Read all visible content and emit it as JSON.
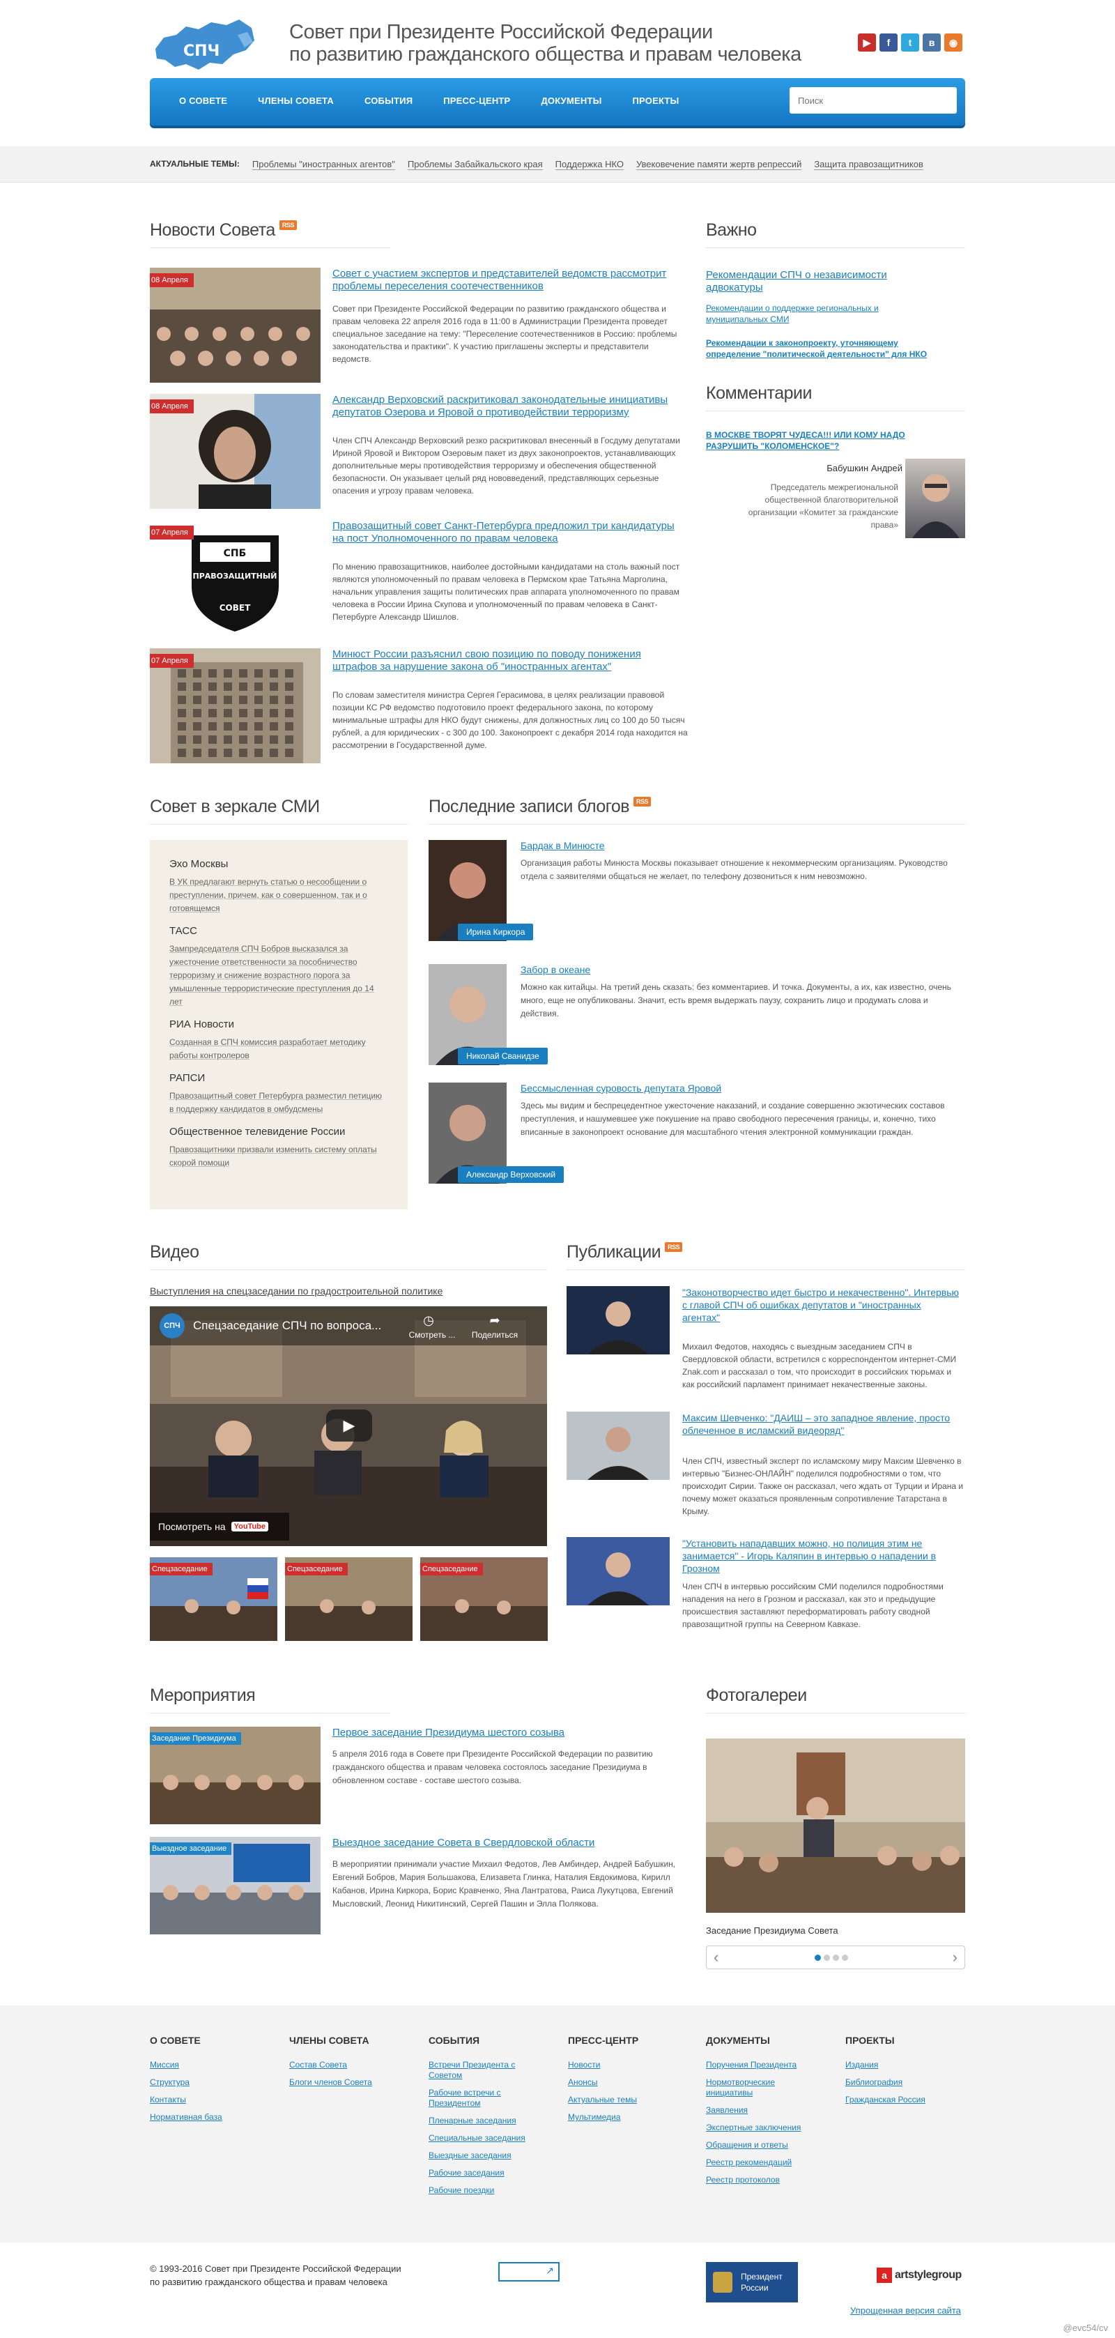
{
  "header": {
    "logo_text": "СПЧ",
    "title_line1": "Совет при Президенте Российской Федерации",
    "title_line2": "по развитию гражданского общества и правам человека",
    "social": [
      {
        "name": "youtube-icon",
        "glyph": "▶",
        "color": "#c8312b"
      },
      {
        "name": "facebook-icon",
        "glyph": "f",
        "color": "#3b5998"
      },
      {
        "name": "twitter-icon",
        "glyph": "t",
        "color": "#2fa8e0"
      },
      {
        "name": "vk-icon",
        "glyph": "в",
        "color": "#4c75a3"
      },
      {
        "name": "rss-icon",
        "glyph": "◉",
        "color": "#e9792d"
      }
    ]
  },
  "nav": {
    "items": [
      "О совете",
      "Члены совета",
      "События",
      "Пресс-центр",
      "Документы",
      "Проекты"
    ],
    "search_placeholder": "Поиск"
  },
  "topics": {
    "label": "Актуальные темы:",
    "items": [
      "Проблемы \"иностранных агентов\"",
      "Проблемы Забайкальского края",
      "Поддержка НКО",
      "Увековечение памяти жертв репрессий",
      "Защита правозащитников"
    ]
  },
  "news": {
    "title": "Новости Совета",
    "rss": "RSS",
    "items": [
      {
        "date": "08 Апреля",
        "title": "Совет с участием экспертов и представителей ведомств рассмотрит проблемы переселения соотечественников",
        "text": "Совет при Президенте Российской Федерации по развитию гражданского общества и правам человека 22 апреля 2016 года в 11:00 в Администрации Президента проведет специальное заседание на тему: \"Переселение соотечественников в Россию: проблемы законодательства и практики\". К участию приглашены эксперты и представители ведомств."
      },
      {
        "date": "08 Апреля",
        "title": "Александр Верховский раскритиковал законодательные инициативы депутатов Озерова и Яровой о противодействии терроризму",
        "text": "Член СПЧ Александр Верховский резко раскритиковал внесенный в Госдуму депутатами Ириной Яровой и Виктором Озеровым пакет из двух законопроектов, устанавливающих дополнительные меры противодействия терроризму и обеспечения общественной безопасности. Он указывает целый ряд нововведений, представляющих серьезные опасения и угрозу правам человека."
      },
      {
        "date": "07 Апреля",
        "title": "Правозащитный совет Санкт-Петербурга предложил три кандидатуры на пост Уполномоченного по правам человека",
        "text": "По мнению правозащитников, наиболее достойными кандидатами на столь важный пост являются уполномоченный по правам человека в Пермском крае Татьяна Марголина, начальник управления защиты политических прав аппарата уполномоченного по правам человека в России Ирина Скупова и уполномоченный по правам человека в Санкт-Петербурге Александр Шишлов."
      },
      {
        "date": "07 Апреля",
        "title": "Минюст России разъяснил свою позицию по поводу понижения штрафов за нарушение закона об \"иностранных агентах\"",
        "text": "По словам заместителя министра Сергея Герасимова, в целях реализации правовой позиции КС РФ ведомство подготовило проект федерального закона, по которому минимальные штрафы для НКО будут снижены, для должностных лиц со 100 до 50 тысяч рублей, а для юридических - с 300 до 100. Законопроект с декабря 2014 года находится на рассмотрении в Государственной думе."
      }
    ],
    "logo_badge_top": "СПБ",
    "logo_badge_mid": "ПРАВОЗАЩИТНЫЙ",
    "logo_badge_bottom": "СОВЕТ"
  },
  "important": {
    "title": "Важно",
    "links": [
      "Рекомендации СПЧ о независимости адвокатуры",
      "Рекомендации о поддержке региональных и муниципальных СМИ",
      "Рекомендации к законопроекту, уточняющему определение \"политической деятельности\" для НКО"
    ]
  },
  "comments": {
    "title": "Комментарии",
    "link": "В МОСКВЕ ТВОРЯТ ЧУДЕСА!!! ИЛИ КОМУ НАДО РАЗРУШИТЬ \"КОЛОМЕНСКОЕ\"?",
    "author": "Бабушкин Андрей",
    "role": "Председатель межрегиональной общественной благотворительной организации «Комитет за гражданские права»"
  },
  "smi": {
    "title": "Совет в зеркале СМИ",
    "items": [
      {
        "source": "Эхо Москвы",
        "text": "В УК предлагают вернуть статью о несообщении о преступлении, причем, как о совершенном, так и о готовящемся"
      },
      {
        "source": "ТАСС",
        "text": "Зампредседателя СПЧ Бобров высказался за ужесточение ответственности за пособничество терроризму и снижение возрастного порога за умышленные террористические преступления до 14 лет"
      },
      {
        "source": "РИА Новости",
        "text": "Созданная в СПЧ комиссия разработает методику работы контролеров"
      },
      {
        "source": "РАПСИ",
        "text": "Правозащитный совет Петербурга разместил петицию в поддержку кандидатов в омбудсмены"
      },
      {
        "source": "Общественное телевидение России",
        "text": "Правозащитники призвали изменить систему оплаты скорой помощи"
      }
    ]
  },
  "blogs": {
    "title": "Последние записи блогов",
    "rss": "RSS",
    "items": [
      {
        "author": "Ирина Киркора",
        "title": "Бардак в Минюсте",
        "text": "Организация работы Минюста Москвы показывает отношение  к некоммерческим организациям. Руководство отдела с заявителями общаться не желает, по телефону дозвониться к ним невозможно."
      },
      {
        "author": "Николай Сванидзе",
        "title": "Забор в океане",
        "text": "Можно как китайцы. На третий день сказать: без комментариев. И точка. Документы, а их, как известно, очень много, еще не опубликованы. Значит, есть время выдержать паузу, сохранить лицо и продумать слова и действия."
      },
      {
        "author": "Александр Верховский",
        "title": "Бессмысленная суровость депутата Яровой",
        "text": "Здесь мы видим и беспрецедентное ужесточение наказаний, и создание совершенно экзотических составов преступления, и нашумевшее уже покушение на право свободного пересечения границы, и, конечно, тихо вписанные в законопроект основание для масштабного чтения электронной коммуникации граждан."
      }
    ]
  },
  "video": {
    "title": "Видео",
    "caption": "Выступления на спецзаседании по градостроительной политике",
    "player_title": "Спецзаседание СПЧ по вопроса...",
    "later": "Смотреть ...",
    "share": "Поделиться",
    "watch_on": "Посмотреть на",
    "youtube": "YouTube",
    "thumbs": [
      "Спецзаседание",
      "Спецзаседание",
      "Спецзаседание"
    ]
  },
  "publications": {
    "title": "Публикации",
    "rss": "RSS",
    "items": [
      {
        "title": "\"Законотворчество идет быстро и некачественно\". Интервью с главой СПЧ об ошибках депутатов и \"иностранных агентах\"",
        "text": "Михаил Федотов, находясь с выездным заседанием СПЧ в Свердловской области, встретился с корреспондентом интернет-СМИ Znak.com и рассказал о том, что происходит в российских тюрьмах и как российский парламент принимает некачественные законы."
      },
      {
        "title": "Максим Шевченко: \"ДАИШ – это западное явление, просто облеченное в исламский видеоряд\"",
        "text": "Член СПЧ,  известный эксперт по исламскому миру Максим Шевченко в интервью \"Бизнес-ОНЛАЙН\" поделился подробностями о том, что происходит Сирии. Также он рассказал, чего ждать от Турции и Ирана и почему может оказаться проявленным сопротивление Татарстана в Крыму."
      },
      {
        "title": "\"Установить нападавших можно, но полиция этим не занимается\" - Игорь Каляпин в интервью о нападении в Грозном",
        "text": "Член СПЧ в интервью российским СМИ поделился подробностями нападения на него в Грозном и рассказал, как это и предыдущие происшествия заставляют переформатировать работу сводной правозащитной группы на Северном Кавказе."
      }
    ]
  },
  "events": {
    "title": "Мероприятия",
    "items": [
      {
        "tag": "Заседание Президиума",
        "title": "Первое заседание Президиума шестого созыва",
        "text": "5 апреля 2016 года в Совете при Президенте Российской Федерации по развитию гражданского общества и правам человека состоялось заседание Президиума в обновленном составе - составе шестого созыва."
      },
      {
        "tag": "Выездное заседание",
        "title": "Выездное заседание Совета в Свердловской области",
        "text": "В мероприятии принимали участие Михаил Федотов,  Лев Амбиндер, Андрей Бабушкин, Евгений Бобров, Мария Большакова, Елизавета Глинка, Наталия Евдокимова, Кирилл Кабанов, Ирина Киркора, Борис Кравченко, Яна Лантратова, Раиса Лукутцова, Евгений Мысловский, Леонид Никитинский, Сергей Пашин и Элла Полякова."
      }
    ]
  },
  "gallery": {
    "title": "Фотогалереи",
    "caption": "Заседание Президиума Совета",
    "prev": "‹",
    "next": "›"
  },
  "footer": {
    "columns": [
      {
        "title": "О совете",
        "links": [
          "Миссия",
          "Структура",
          "Контакты",
          "Нормативная база"
        ]
      },
      {
        "title": "Члены совета",
        "links": [
          "Состав Совета",
          "Блоги членов Совета"
        ]
      },
      {
        "title": "События",
        "links": [
          "Встречи Президента с Советом",
          "Рабочие встречи с Президентом",
          "Пленарные заседания",
          "Специальные заседания",
          "Выездные заседания",
          "Рабочие заседания",
          "Рабочие поездки"
        ]
      },
      {
        "title": "Пресс-центр",
        "links": [
          "Новости",
          "Анонсы",
          "Актуальные темы",
          "Мультимедиа"
        ]
      },
      {
        "title": "Документы",
        "links": [
          "Поручения Президента",
          "Нормотворческие инициативы",
          "Заявления",
          "Экспертные заключения",
          "Обращения и ответы",
          "Реестр рекомендаций",
          "Реестр протоколов"
        ]
      },
      {
        "title": "Проекты",
        "links": [
          "Издания",
          "Библиография",
          "Гражданская Россия"
        ]
      }
    ],
    "copyright_line1": "© 1993-2016 Совет при Президенте Российской Федерации",
    "copyright_line2": "по развитию гражданского общества и правам человека",
    "president_line1": "Президент",
    "president_line2": "России",
    "artstyle": "artstylegroup",
    "simple_version": "Упрощенная версия сайта",
    "watermark": "@evc54/cv"
  },
  "colors": {
    "accent": "#1a7fc1",
    "nav_blue": "#2186c7",
    "red_tag": "#cf2e2e",
    "rss_orange": "#e9792d",
    "smi_bg": "#f4efe6"
  }
}
